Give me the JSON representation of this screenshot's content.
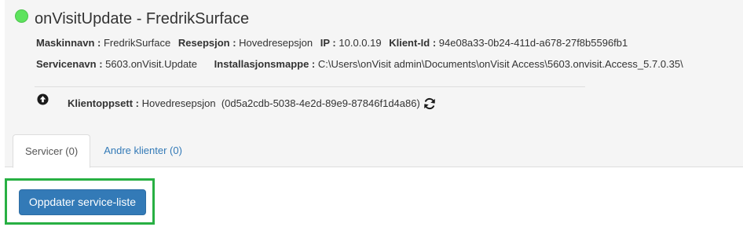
{
  "header": {
    "title": "onVisitUpdate - FredrikSurface",
    "status_color": "#5ee35e"
  },
  "info": {
    "maskinnavn_label": "Maskinnavn :",
    "maskinnavn_value": "FredrikSurface",
    "resepsjon_label": "Resepsjon :",
    "resepsjon_value": "Hovedresepsjon",
    "ip_label": "IP :",
    "ip_value": "10.0.0.19",
    "klientid_label": "Klient-Id :",
    "klientid_value": "94e08a33-0b24-411d-a678-27f8b5596fb1",
    "servicenavn_label": "Servicenavn :",
    "servicenavn_value": "5603.onVisit.Update",
    "installasjonsmappe_label": "Installasjonsmappe :",
    "installasjonsmappe_value": "C:\\Users\\onVisit admin\\Documents\\onVisit Access\\5603.onvisit.Access_5.7.0.35\\"
  },
  "client_setup": {
    "label": "Klientoppsett :",
    "name": "Hovedresepsjon",
    "id": "(0d5a2cdb-5038-4e2d-89e9-87846f1d4a86)",
    "icon": "arrow-circle-up-icon",
    "refresh_icon": "refresh-icon"
  },
  "tabs": [
    {
      "label": "Servicer (0)",
      "active": true
    },
    {
      "label": "Andre klienter (0)",
      "active": false
    }
  ],
  "actions": {
    "update_button_label": "Oppdater service-liste",
    "highlight_color": "#28b043",
    "button_color": "#337ab7"
  }
}
